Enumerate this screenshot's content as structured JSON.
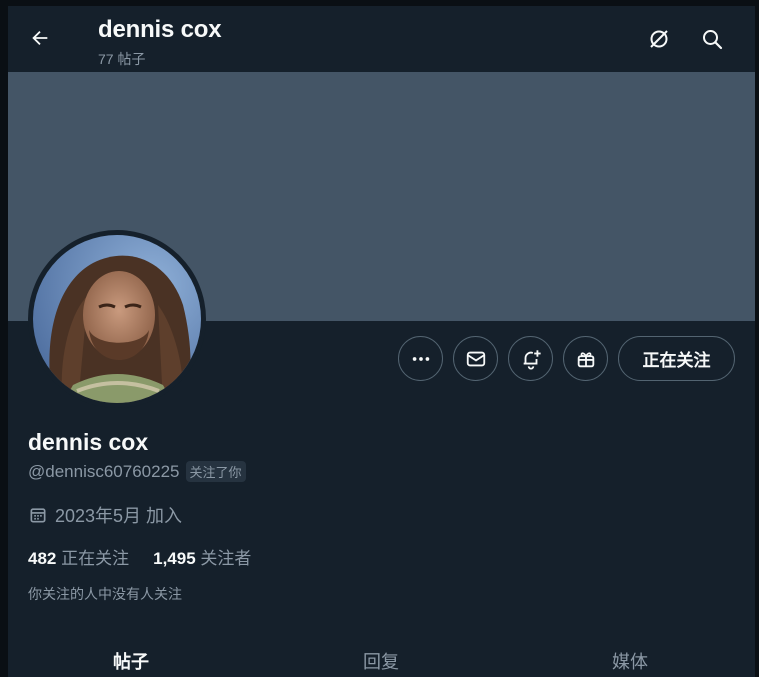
{
  "header": {
    "title": "dennis cox",
    "post_count": "77 帖子",
    "icons": [
      "arrow-left-icon",
      "no-translate-icon",
      "search-icon"
    ]
  },
  "profile": {
    "display_name": "dennis cox",
    "handle": "@dennisc60760225",
    "follows_you": "关注了你",
    "joined": "2023年5月 加入",
    "following_count": "482",
    "following_label": "正在关注",
    "followers_count": "1,495",
    "followers_label": "关注者",
    "mutual_note": "你关注的人中没有人关注"
  },
  "actions": {
    "more_icon": "ellipsis-icon",
    "message_icon": "envelope-icon",
    "notify_icon": "bell-plus-icon",
    "gift_icon": "gift-icon",
    "following_button": "正在关注"
  },
  "tabs": [
    {
      "label": "帖子",
      "active": true
    },
    {
      "label": "回复",
      "active": false
    },
    {
      "label": "媒体",
      "active": false
    }
  ],
  "colors": {
    "background": "#15202b",
    "banner": "#445566",
    "text_primary": "#f7f9f9",
    "text_secondary": "#8b98a5",
    "border": "#536471"
  }
}
